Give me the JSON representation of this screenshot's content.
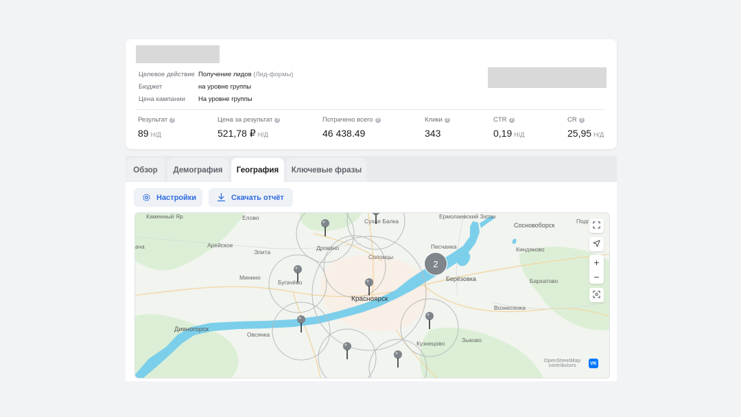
{
  "campaign": {
    "info": [
      {
        "label": "Целевое действие",
        "value": "Получение лидов",
        "hint": "(Лид-формы)"
      },
      {
        "label": "Бюджет",
        "value": "на уровне группы",
        "hint": ""
      },
      {
        "label": "Цена кампании",
        "value": "На уровне группы",
        "hint": ""
      }
    ],
    "metrics": [
      {
        "label": "Результат",
        "value": "89",
        "suffix": "Н/Д"
      },
      {
        "label": "Цена за результат",
        "value": "521,78 ₽",
        "suffix": "Н/Д"
      },
      {
        "label": "Потрачено всего",
        "value": "46 438.49",
        "suffix": ""
      },
      {
        "label": "Клики",
        "value": "343",
        "suffix": ""
      },
      {
        "label": "CTR",
        "value": "0,19",
        "suffix": "Н/Д"
      },
      {
        "label": "CR",
        "value": "25,95",
        "suffix": "Н/Д"
      }
    ]
  },
  "tabs": [
    {
      "label": "Обзор",
      "active": false
    },
    {
      "label": "Демография",
      "active": false
    },
    {
      "label": "География",
      "active": true
    },
    {
      "label": "Ключевые фразы",
      "active": false
    }
  ],
  "toolbar": {
    "settings_label": "Настройки",
    "download_label": "Скачать отчёт"
  },
  "map": {
    "places": {
      "kamenny_yar": "Каменный Яр",
      "elovoe": "Елово",
      "sukhaya_balka": "Сухая Балка",
      "ermolaevsky_zaton": "Ермолаевский Затон",
      "sosnovoborsk": "Сосновоборск",
      "podg": "Подг",
      "acha": "ача",
      "areyskoe": "Арейское",
      "drokino": "Дрокино",
      "elita": "Элита",
      "solontsy": "Солонцы",
      "peschanka": "Песчанка",
      "kindyakovo": "Киндяково",
      "minino": "Минино",
      "bugachevo": "Бугачёво",
      "berezovka": "Берёзовка",
      "barkhatovo": "Бархатово",
      "krasnoyarsk": "Красноярск",
      "voznesenka": "Вознесенка",
      "divnogorsk": "Дивногорск",
      "ovsyanka": "Овсянка",
      "kuznetsovo": "Кузнецово",
      "zykovo": "Зыково"
    },
    "cluster_count": "2",
    "attribution_line1": "OpenStreetMap",
    "attribution_line2": "contributors",
    "attribution_logo": "VK",
    "zoom_in": "+",
    "zoom_out": "−"
  },
  "colors": {
    "accent": "#2d6cdf",
    "water": "#7ccfea",
    "placeholder": "#d9d9d9",
    "marker": "#7f858b"
  }
}
